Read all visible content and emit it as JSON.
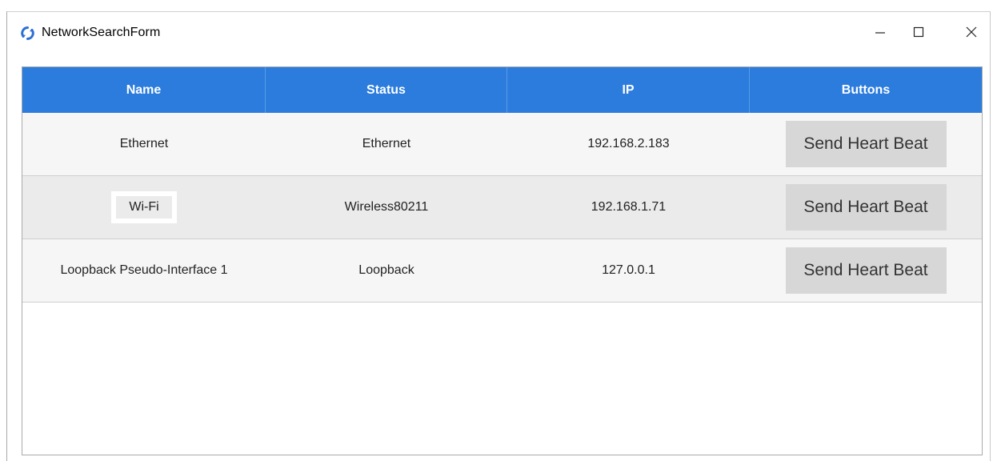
{
  "window": {
    "title": "NetworkSearchForm",
    "icon": "app-sync-icon",
    "controls": {
      "minimize_icon": "minimize-icon",
      "maximize_icon": "maximize-icon",
      "close_icon": "close-icon"
    }
  },
  "grid": {
    "header_color": "#2b7cdd",
    "columns": [
      "Name",
      "Status",
      "IP",
      "Buttons"
    ],
    "rows": [
      {
        "name": "Ethernet",
        "status": "Ethernet",
        "ip": "192.168.2.183",
        "button": "Send Heart Beat"
      },
      {
        "name": "Wi-Fi",
        "status": "Wireless80211",
        "ip": "192.168.1.71",
        "button": "Send Heart Beat"
      },
      {
        "name": "Loopback Pseudo-Interface 1",
        "status": "Loopback",
        "ip": "127.0.0.1",
        "button": "Send Heart Beat"
      }
    ]
  }
}
